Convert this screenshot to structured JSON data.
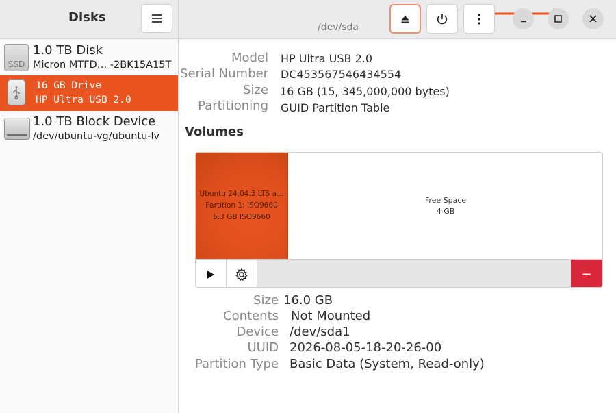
{
  "app": {
    "title": "Disks"
  },
  "header": {
    "device_path": "/dev/sda"
  },
  "devices": [
    {
      "line1": "1.0 TB Disk",
      "line2": "Micron MTFD…  -2BK15A15T",
      "icon": "ssd-icon",
      "icon_label": "SSD"
    },
    {
      "line1": "16 GB Drive",
      "line2": "HP Ultra USB 2.0",
      "icon": "usb-drive-icon"
    },
    {
      "line1": "1.0 TB Block Device",
      "line2": "/dev/ubuntu-vg/ubuntu-lv",
      "icon": "block-device-icon"
    }
  ],
  "drive_info": {
    "model_label": "Model",
    "model": "HP Ultra USB 2.0",
    "serial_label": "Serial Number",
    "serial": "DC453567546434554",
    "size_label": "Size",
    "size": "16 GB (15, 345,000,000 bytes)",
    "partitioning_label": "Partitioning",
    "partitioning": "GUID Partition Table"
  },
  "volumes": {
    "title": "Volumes",
    "partition": {
      "line1": "Ubuntu 24.04.3 LTS a…",
      "line2": "Partition 1: ISO9660",
      "line3": "6.3 GB ISO9660"
    },
    "free_space": {
      "label": "Free Space",
      "size": "4 GB"
    },
    "delete_symbol": "−"
  },
  "partition_info": {
    "size_label": "Size",
    "size": "16.0 GB",
    "contents_label": "Contents",
    "contents": "Not Mounted",
    "device_label": "Device",
    "device": "/dev/sda1",
    "uuid_label": "UUID",
    "uuid": "2026-08-05-18-20-26-00",
    "type_label": "Partition Type",
    "type": "Basic Data (System, Read-only)"
  },
  "colors": {
    "accent": "#e95420",
    "annotation_arrow": "#e95420",
    "delete": "#d8263b"
  }
}
